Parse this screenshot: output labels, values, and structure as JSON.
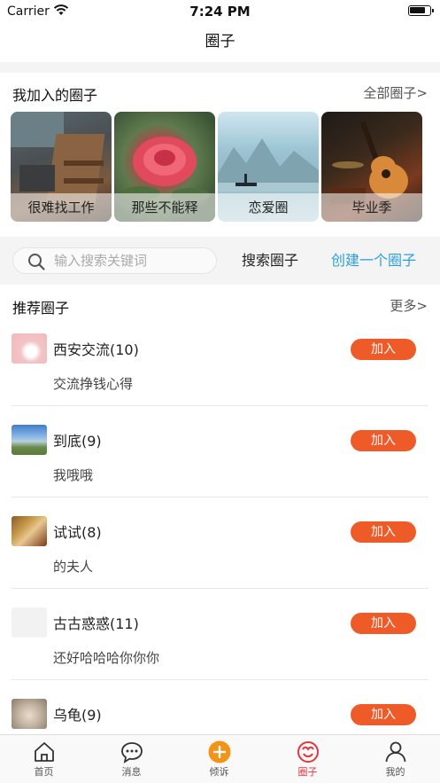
{
  "status_bar": {
    "carrier": "Carrier",
    "time": "7:24 PM"
  },
  "nav": {
    "title": "圈子"
  },
  "my_circles": {
    "title": "我加入的圈子",
    "more": "全部圈子>",
    "items": [
      {
        "label": "很难找工作"
      },
      {
        "label": "那些不能释"
      },
      {
        "label": "恋爱圈"
      },
      {
        "label": "毕业季"
      }
    ]
  },
  "search": {
    "placeholder": "输入搜索关键词",
    "search_label": "搜索圈子",
    "create_label": "创建一个圈子"
  },
  "recommended": {
    "title": "推荐圈子",
    "more": "更多>",
    "items": [
      {
        "name": "西安交流(10)",
        "desc": "交流挣钱心得",
        "join": "加入"
      },
      {
        "name": "到底(9)",
        "desc": "我哦哦",
        "join": "加入"
      },
      {
        "name": "试试(8)",
        "desc": "的夫人",
        "join": "加入"
      },
      {
        "name": "古古惑惑(11)",
        "desc": "还好哈哈哈你你你",
        "join": "加入"
      },
      {
        "name": "乌龟(9)",
        "desc": "",
        "join": "加入"
      }
    ]
  },
  "tab_bar": {
    "tabs": [
      {
        "label": "首页",
        "icon": "home-icon"
      },
      {
        "label": "消息",
        "icon": "message-icon"
      },
      {
        "label": "倾诉",
        "icon": "plus-icon"
      },
      {
        "label": "圈子",
        "icon": "circle-icon",
        "active": true
      },
      {
        "label": "我的",
        "icon": "user-icon"
      }
    ],
    "active_color": "#e8333a",
    "accent_color": "#f39317"
  },
  "colors": {
    "join_button": "#ee5a28",
    "create_link": "#2a9fe0"
  }
}
